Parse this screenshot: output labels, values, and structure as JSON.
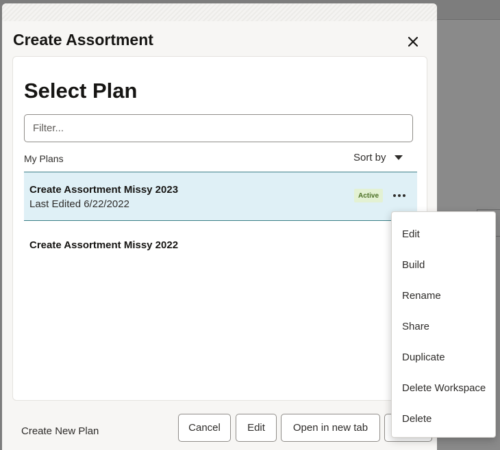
{
  "dialog": {
    "title": "Create Assortment",
    "close_icon": "close-icon"
  },
  "card": {
    "title": "Select Plan",
    "filter": {
      "value": "",
      "placeholder": "Filter..."
    },
    "list_label": "My Plans",
    "sort_label": "Sort by",
    "plans": [
      {
        "name": "Create Assortment Missy 2023",
        "subtitle": "Last Edited 6/22/2022",
        "badge": "Active",
        "selected": true
      },
      {
        "name": "Create Assortment Missy 2022",
        "subtitle": "",
        "badge": "",
        "selected": false
      }
    ]
  },
  "footer": {
    "create_new": "Create New Plan",
    "cancel": "Cancel",
    "edit": "Edit",
    "open_new_tab": "Open in new tab"
  },
  "context_menu": {
    "items": [
      "Edit",
      "Build",
      "Rename",
      "Share",
      "Duplicate",
      "Delete Workspace",
      "Delete"
    ]
  },
  "colors": {
    "selected_row": "#dff0f6",
    "accent_rule": "#3a7d86",
    "badge_bg": "#e3f1d3",
    "badge_text": "#4b6f24"
  }
}
